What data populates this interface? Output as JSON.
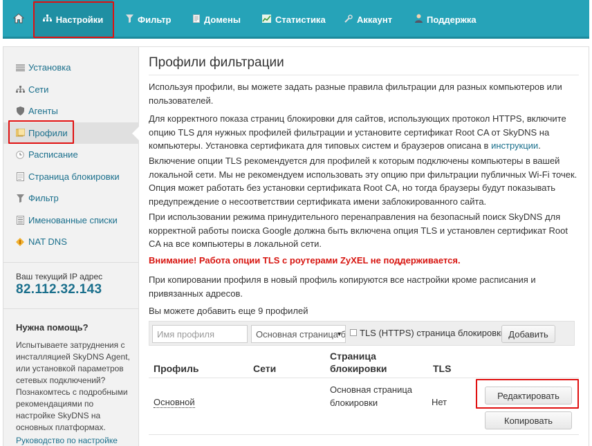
{
  "nav": {
    "home_icon": "home-icon",
    "items": [
      {
        "label": "Настройки",
        "icon": "settings-icon"
      },
      {
        "label": "Фильтр",
        "icon": "filter-icon"
      },
      {
        "label": "Домены",
        "icon": "document-icon"
      },
      {
        "label": "Статистика",
        "icon": "chart-icon"
      },
      {
        "label": "Аккаунт",
        "icon": "wrench-icon"
      },
      {
        "label": "Поддержка",
        "icon": "user-icon"
      }
    ]
  },
  "sidebar": {
    "items": [
      {
        "label": "Установка",
        "icon": "list-icon"
      },
      {
        "label": "Сети",
        "icon": "network-icon"
      },
      {
        "label": "Агенты",
        "icon": "shield-icon"
      },
      {
        "label": "Профили",
        "icon": "profiles-icon"
      },
      {
        "label": "Расписание",
        "icon": "clock-icon"
      },
      {
        "label": "Страница блокировки",
        "icon": "block-page-icon"
      },
      {
        "label": "Фильтр",
        "icon": "filter-icon"
      },
      {
        "label": "Именованные списки",
        "icon": "named-list-icon"
      },
      {
        "label": "NAT DNS",
        "icon": "nat-icon"
      }
    ],
    "ip_label": "Ваш текущий IP адрес",
    "ip_value": "82.112.32.143",
    "help_title": "Нужна помощь?",
    "help_text": "Испытываете затруднения с инсталляцией SkyDNS Agent, или установкой параметров сетевых подключений? Познакомтесь с подробными рекомендациями по настройке SkyDNS на основных платформах.",
    "help_link": "Руководство по настройке"
  },
  "main": {
    "title": "Профили фильтрации",
    "p1": "Используя профили, вы можете задать разные правила фильтрации для разных компьютеров или пользователей.",
    "p2": "Для корректного показа страниц блокировки для сайтов, использующих протокол HTTPS, включите опцию TLS для нужных профилей фильтрации и установите сертификат Root CA от SkyDNS на компьютеры. Установка сертификата для типовых систем и браузеров описана в ",
    "p2_link": "инструкции",
    "p2_end": ".",
    "p3": "Включение опции TLS рекомендуется для профилей к которым подключены компьютеры в вашей локальной сети. Мы не рекомендуем использовать эту опцию при фильтрации публичных Wi-Fi точек. Опция может работать без установки сертификата Root CA, но тогда браузеры будут показывать предупреждение о несоответствии сертификата имени заблокированного сайта.",
    "p4": "При использовании режима принудительного перенаправления на безопасный поиск SkyDNS для корректной работы поиска Google должна быть включена опция TLS и установлен сертификат Root CA на все компьютеры в локальной сети.",
    "warning": "Внимание! Работа опции TLS с роутерами ZyXEL не поддерживается.",
    "p5": "При копировании профиля в новый профиль копируются все настройки кроме расписания и привязанных адресов.",
    "p6": "Вы можете добавить еще 9 профилей"
  },
  "add_form": {
    "name_placeholder": "Имя профиля",
    "page_select_value": "Основная страница блокировки",
    "tls_checked": false,
    "tls_label": "TLS (HTTPS) страница блокировки",
    "add_button": "Добавить"
  },
  "table": {
    "headers": {
      "profile": "Профиль",
      "networks": "Сети",
      "block_page": "Страница блокировки",
      "tls": "TLS"
    },
    "rows": [
      {
        "profile": "Основной",
        "networks": "",
        "block_page": "Основная страница блокировки",
        "tls": "Нет",
        "edit": "Редактировать",
        "copy": "Копировать"
      }
    ]
  }
}
